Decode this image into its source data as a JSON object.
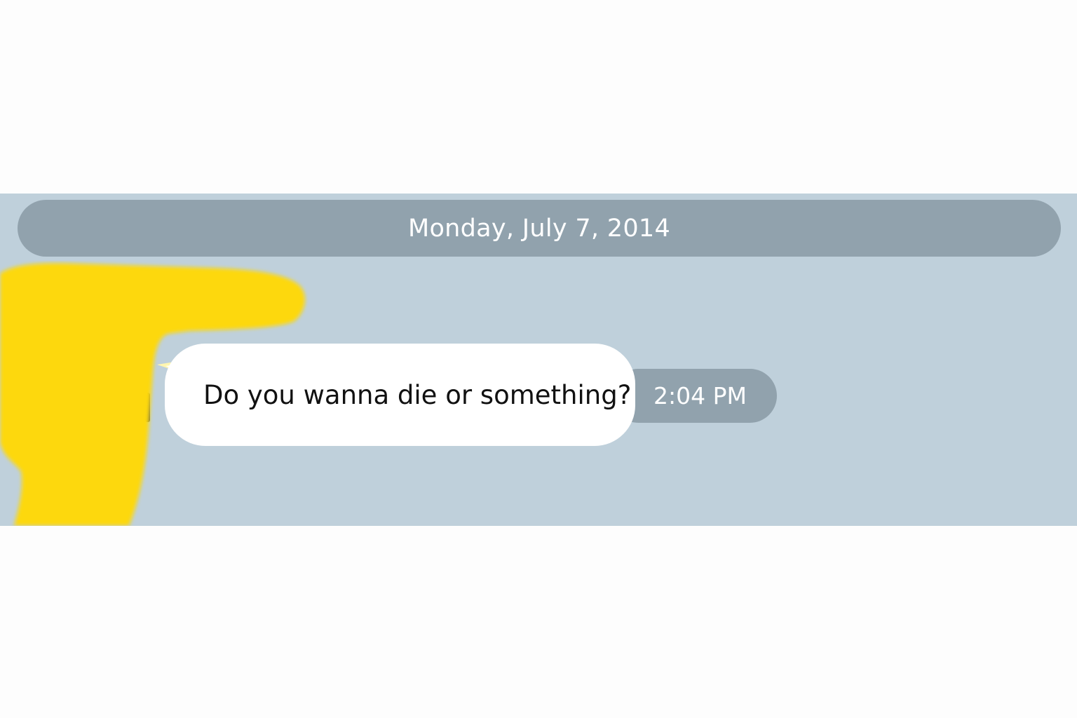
{
  "conversation": {
    "date_separator": "Monday, July 7, 2014",
    "messages": [
      {
        "text": "Do you wanna die or something?",
        "time": "2:04 PM",
        "direction": "incoming"
      }
    ]
  },
  "colors": {
    "chat_background": "#bfd0db",
    "pill_background": "#91a2ad",
    "bubble_background": "#ffffff",
    "redaction": "#fdd808",
    "page_background": "#fdfdfd"
  },
  "icons": {
    "sender_avatar": "avatar-icon",
    "redaction": "redaction-mark"
  }
}
